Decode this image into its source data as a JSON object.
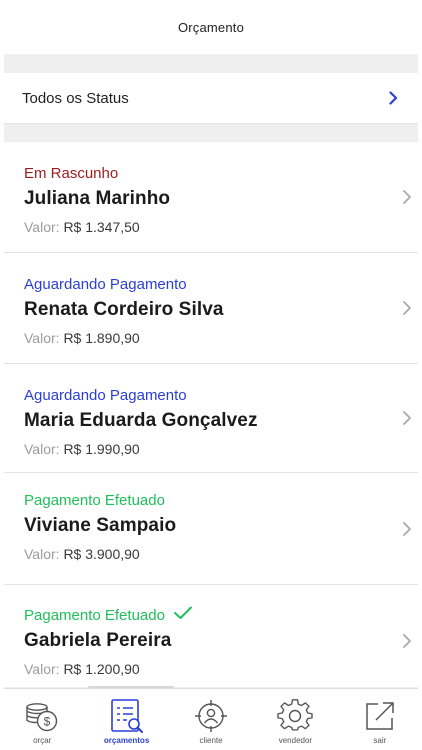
{
  "header": {
    "title": "Orçamento"
  },
  "filter": {
    "label": "Todos os Status"
  },
  "colors": {
    "draft": "#9b1c1c",
    "awaiting": "#2a3fd6",
    "paid": "#1fbf5a",
    "accent": "#2a3fd6"
  },
  "items": [
    {
      "status": "Em Rascunho",
      "status_key": "draft",
      "name": "Juliana Marinho",
      "value_label": "Valor:",
      "value": "R$ 1.347,50",
      "check": false
    },
    {
      "status": "Aguardando Pagamento",
      "status_key": "awaiting",
      "name": "Renata Cordeiro Silva",
      "value_label": "Valor:",
      "value": "R$ 1.890,90",
      "check": false
    },
    {
      "status": "Aguardando Pagamento",
      "status_key": "awaiting",
      "name": "Maria Eduarda Gonçalvez",
      "value_label": "Valor:",
      "value": "R$ 1.990,90",
      "check": false
    },
    {
      "status": "Pagamento Efetuado",
      "status_key": "paid",
      "name": "Viviane Sampaio",
      "value_label": "Valor:",
      "value": "R$ 3.900,90",
      "check": false
    },
    {
      "status": "Pagamento Efetuado",
      "status_key": "paid",
      "name": "Gabriela Pereira",
      "value_label": "Valor:",
      "value": "R$ 1.200,90",
      "check": true
    }
  ],
  "tabs": [
    {
      "label": "orçar",
      "icon": "coins-dollar-icon",
      "active": false
    },
    {
      "label": "orçamentos",
      "icon": "document-search-icon",
      "active": true
    },
    {
      "label": "cliente",
      "icon": "user-target-icon",
      "active": false
    },
    {
      "label": "vendedor",
      "icon": "gear-icon",
      "active": false
    },
    {
      "label": "sair",
      "icon": "exit-arrow-icon",
      "active": false
    }
  ]
}
